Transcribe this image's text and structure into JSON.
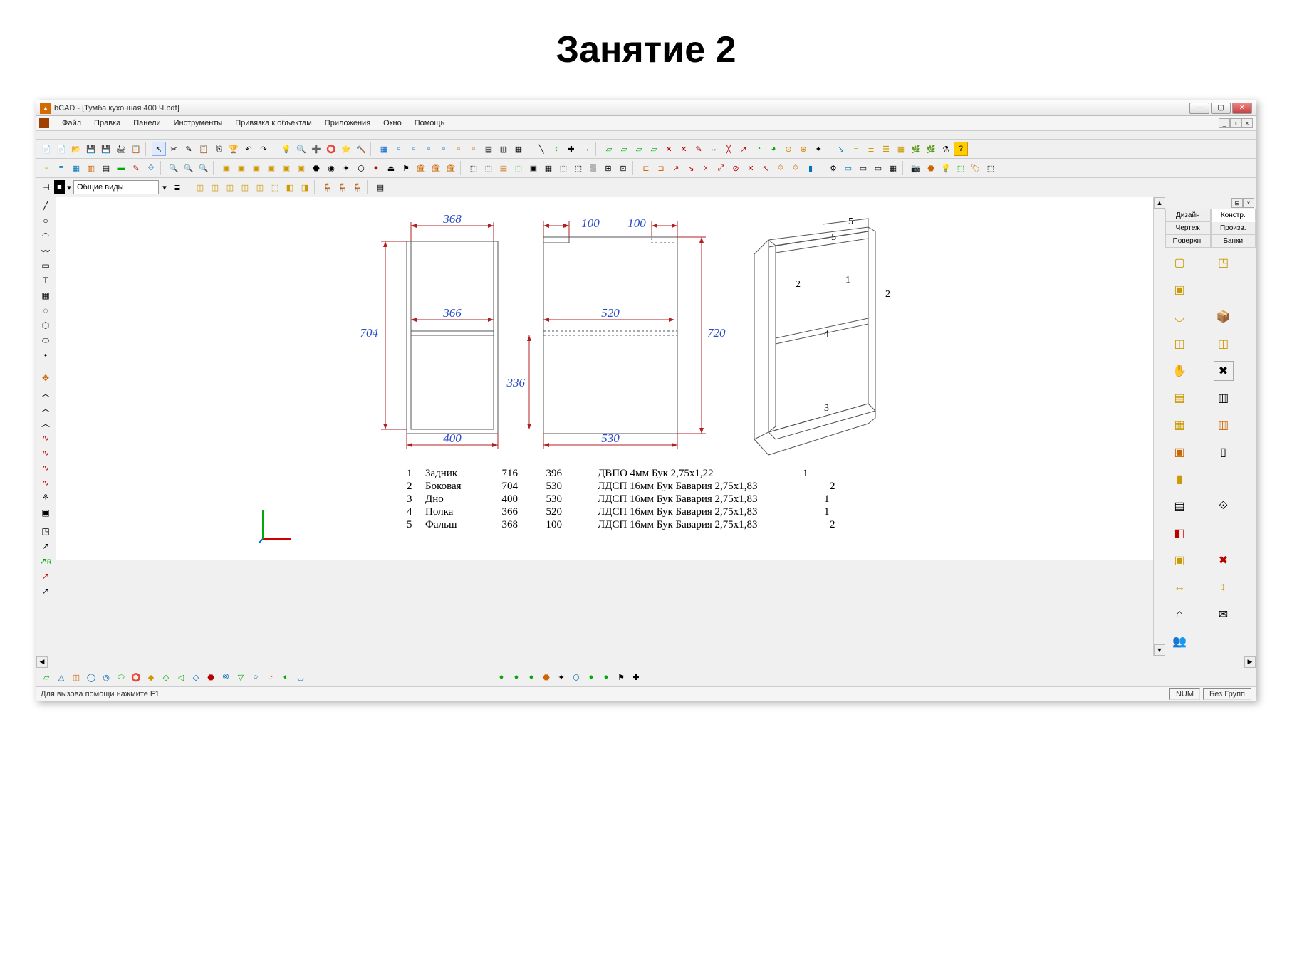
{
  "slide_title": "Занятие 2",
  "title": "bCAD - [Тумба кухонная 400 Ч.bdf]",
  "menu": [
    "Файл",
    "Правка",
    "Панели",
    "Инструменты",
    "Привязка к объектам",
    "Приложения",
    "Окно",
    "Помощь"
  ],
  "view_select": "Общие виды",
  "right_tabs": [
    "Дизайн",
    "Констр.",
    "Чертеж",
    "Произв.",
    "Поверхн.",
    "Банки"
  ],
  "status_hint": "Для вызова помощи нажмите F1",
  "status_num": "NUM",
  "status_grp": "Без Групп",
  "dims": {
    "d368": "368",
    "d366": "366",
    "d704": "704",
    "d400": "400",
    "d100a": "100",
    "d100b": "100",
    "d520": "520",
    "d530": "530",
    "d336": "336",
    "d720": "720"
  },
  "iso_labels": {
    "p1": "1",
    "p2": "2",
    "p2b": "2",
    "p3": "3",
    "p4": "4",
    "p5a": "5",
    "p5b": "5"
  },
  "spec": [
    {
      "n": "1",
      "name": "Задник",
      "a": "716",
      "b": "396",
      "mat": "ДВПО 4мм Бук 2,75x1,22",
      "q": "1"
    },
    {
      "n": "2",
      "name": "Боковая",
      "a": "704",
      "b": "530",
      "mat": "ЛДСП 16мм Бук Бавария 2,75x1,83",
      "q": "2"
    },
    {
      "n": "3",
      "name": "Дно",
      "a": "400",
      "b": "530",
      "mat": "ЛДСП 16мм Бук Бавария 2,75x1,83",
      "q": "1"
    },
    {
      "n": "4",
      "name": "Полка",
      "a": "366",
      "b": "520",
      "mat": "ЛДСП 16мм Бук Бавария 2,75x1,83",
      "q": "1"
    },
    {
      "n": "5",
      "name": "Фальш",
      "a": "368",
      "b": "100",
      "mat": "ЛДСП 16мм Бук Бавария 2,75x1,83",
      "q": "2"
    }
  ]
}
